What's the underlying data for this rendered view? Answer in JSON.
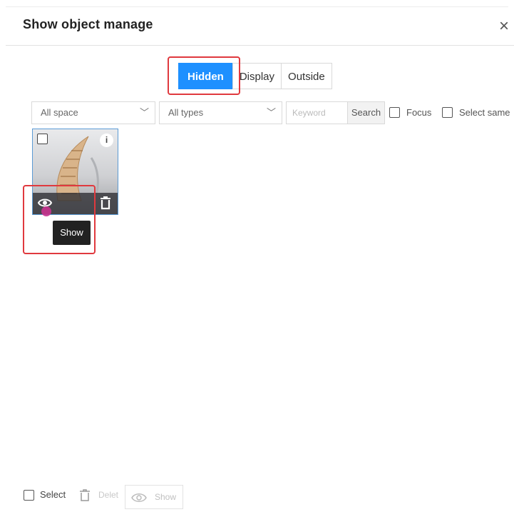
{
  "dialog": {
    "title": "Show object manage",
    "close_icon": "close-icon",
    "close_glyph": "×"
  },
  "tabs": [
    {
      "label": "Hidden",
      "active": true
    },
    {
      "label": "Display",
      "active": false
    },
    {
      "label": "Outside",
      "active": false
    }
  ],
  "filters": {
    "space_select": "All space",
    "type_select": "All types",
    "keyword_placeholder": "Keyword",
    "search_label": "Search",
    "focus_label": "Focus",
    "select_same_label": "Select same"
  },
  "card": {
    "info_glyph": "i",
    "show_icon": "eye-icon",
    "delete_icon": "trash-icon",
    "tooltip": "Show"
  },
  "footer": {
    "select_label": "Select",
    "delete_label": "Delet",
    "show_label": "Show"
  },
  "colors": {
    "accent": "#1e90ff",
    "highlight": "#e0393e"
  }
}
